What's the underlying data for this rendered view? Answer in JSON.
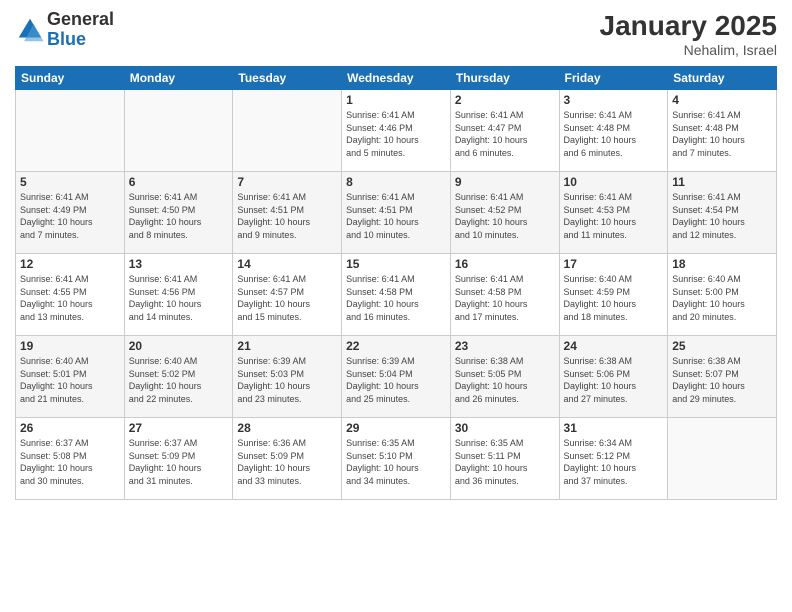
{
  "header": {
    "logo_line1": "General",
    "logo_line2": "Blue",
    "month_year": "January 2025",
    "location": "Nehalim, Israel"
  },
  "weekdays": [
    "Sunday",
    "Monday",
    "Tuesday",
    "Wednesday",
    "Thursday",
    "Friday",
    "Saturday"
  ],
  "weeks": [
    [
      {
        "day": "",
        "info": ""
      },
      {
        "day": "",
        "info": ""
      },
      {
        "day": "",
        "info": ""
      },
      {
        "day": "1",
        "info": "Sunrise: 6:41 AM\nSunset: 4:46 PM\nDaylight: 10 hours\nand 5 minutes."
      },
      {
        "day": "2",
        "info": "Sunrise: 6:41 AM\nSunset: 4:47 PM\nDaylight: 10 hours\nand 6 minutes."
      },
      {
        "day": "3",
        "info": "Sunrise: 6:41 AM\nSunset: 4:48 PM\nDaylight: 10 hours\nand 6 minutes."
      },
      {
        "day": "4",
        "info": "Sunrise: 6:41 AM\nSunset: 4:48 PM\nDaylight: 10 hours\nand 7 minutes."
      }
    ],
    [
      {
        "day": "5",
        "info": "Sunrise: 6:41 AM\nSunset: 4:49 PM\nDaylight: 10 hours\nand 7 minutes."
      },
      {
        "day": "6",
        "info": "Sunrise: 6:41 AM\nSunset: 4:50 PM\nDaylight: 10 hours\nand 8 minutes."
      },
      {
        "day": "7",
        "info": "Sunrise: 6:41 AM\nSunset: 4:51 PM\nDaylight: 10 hours\nand 9 minutes."
      },
      {
        "day": "8",
        "info": "Sunrise: 6:41 AM\nSunset: 4:51 PM\nDaylight: 10 hours\nand 10 minutes."
      },
      {
        "day": "9",
        "info": "Sunrise: 6:41 AM\nSunset: 4:52 PM\nDaylight: 10 hours\nand 10 minutes."
      },
      {
        "day": "10",
        "info": "Sunrise: 6:41 AM\nSunset: 4:53 PM\nDaylight: 10 hours\nand 11 minutes."
      },
      {
        "day": "11",
        "info": "Sunrise: 6:41 AM\nSunset: 4:54 PM\nDaylight: 10 hours\nand 12 minutes."
      }
    ],
    [
      {
        "day": "12",
        "info": "Sunrise: 6:41 AM\nSunset: 4:55 PM\nDaylight: 10 hours\nand 13 minutes."
      },
      {
        "day": "13",
        "info": "Sunrise: 6:41 AM\nSunset: 4:56 PM\nDaylight: 10 hours\nand 14 minutes."
      },
      {
        "day": "14",
        "info": "Sunrise: 6:41 AM\nSunset: 4:57 PM\nDaylight: 10 hours\nand 15 minutes."
      },
      {
        "day": "15",
        "info": "Sunrise: 6:41 AM\nSunset: 4:58 PM\nDaylight: 10 hours\nand 16 minutes."
      },
      {
        "day": "16",
        "info": "Sunrise: 6:41 AM\nSunset: 4:58 PM\nDaylight: 10 hours\nand 17 minutes."
      },
      {
        "day": "17",
        "info": "Sunrise: 6:40 AM\nSunset: 4:59 PM\nDaylight: 10 hours\nand 18 minutes."
      },
      {
        "day": "18",
        "info": "Sunrise: 6:40 AM\nSunset: 5:00 PM\nDaylight: 10 hours\nand 20 minutes."
      }
    ],
    [
      {
        "day": "19",
        "info": "Sunrise: 6:40 AM\nSunset: 5:01 PM\nDaylight: 10 hours\nand 21 minutes."
      },
      {
        "day": "20",
        "info": "Sunrise: 6:40 AM\nSunset: 5:02 PM\nDaylight: 10 hours\nand 22 minutes."
      },
      {
        "day": "21",
        "info": "Sunrise: 6:39 AM\nSunset: 5:03 PM\nDaylight: 10 hours\nand 23 minutes."
      },
      {
        "day": "22",
        "info": "Sunrise: 6:39 AM\nSunset: 5:04 PM\nDaylight: 10 hours\nand 25 minutes."
      },
      {
        "day": "23",
        "info": "Sunrise: 6:38 AM\nSunset: 5:05 PM\nDaylight: 10 hours\nand 26 minutes."
      },
      {
        "day": "24",
        "info": "Sunrise: 6:38 AM\nSunset: 5:06 PM\nDaylight: 10 hours\nand 27 minutes."
      },
      {
        "day": "25",
        "info": "Sunrise: 6:38 AM\nSunset: 5:07 PM\nDaylight: 10 hours\nand 29 minutes."
      }
    ],
    [
      {
        "day": "26",
        "info": "Sunrise: 6:37 AM\nSunset: 5:08 PM\nDaylight: 10 hours\nand 30 minutes."
      },
      {
        "day": "27",
        "info": "Sunrise: 6:37 AM\nSunset: 5:09 PM\nDaylight: 10 hours\nand 31 minutes."
      },
      {
        "day": "28",
        "info": "Sunrise: 6:36 AM\nSunset: 5:09 PM\nDaylight: 10 hours\nand 33 minutes."
      },
      {
        "day": "29",
        "info": "Sunrise: 6:35 AM\nSunset: 5:10 PM\nDaylight: 10 hours\nand 34 minutes."
      },
      {
        "day": "30",
        "info": "Sunrise: 6:35 AM\nSunset: 5:11 PM\nDaylight: 10 hours\nand 36 minutes."
      },
      {
        "day": "31",
        "info": "Sunrise: 6:34 AM\nSunset: 5:12 PM\nDaylight: 10 hours\nand 37 minutes."
      },
      {
        "day": "",
        "info": ""
      }
    ]
  ]
}
